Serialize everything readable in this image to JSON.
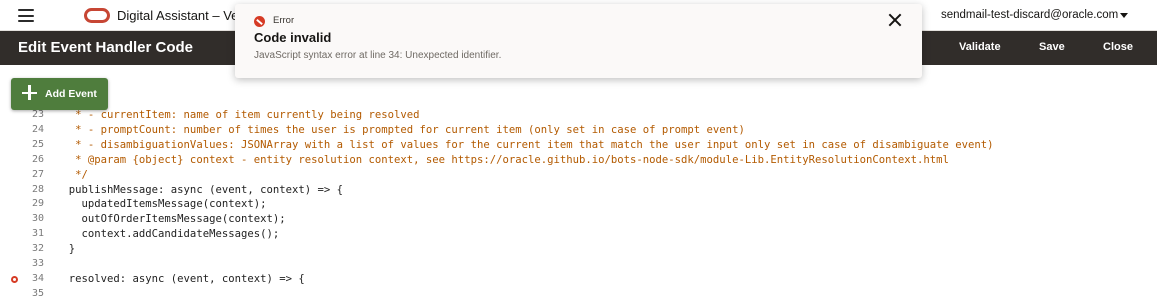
{
  "app": {
    "title": "Digital Assistant – Version",
    "user": "sendmail-test-discard@oracle.com"
  },
  "header": {
    "title": "Edit Event Handler Code",
    "validate_label": "Validate",
    "save_label": "Save",
    "close_label": "Close"
  },
  "add_event_label": "Add Event",
  "toast": {
    "category": "Error",
    "title": "Code invalid",
    "message": "JavaScript syntax error at line 34: Unexpected identifier."
  },
  "colors": {
    "header_bg": "#312d2a",
    "brand_red": "#c74634",
    "add_button": "#4f7d3d",
    "error": "#d63b25",
    "comment": "#b35a00"
  },
  "icons": [
    "hamburger-menu-icon",
    "oracle-logo",
    "user-dropdown-caret-icon",
    "error-icon",
    "close-icon",
    "plus-icon",
    "error-marker-icon"
  ],
  "code": {
    "error_line": 34,
    "lines": [
      {
        "num": "23",
        "text": "   * - currentItem: name of item currently being resolved",
        "kind": "comment"
      },
      {
        "num": "24",
        "text": "   * - promptCount: number of times the user is prompted for current item (only set in case of prompt event)",
        "kind": "comment"
      },
      {
        "num": "25",
        "text": "   * - disambiguationValues: JSONArray with a list of values for the current item that match the user input only set in case of disambiguate event)",
        "kind": "comment"
      },
      {
        "num": "26",
        "text": "   * @param {object} context - entity resolution context, see https://oracle.github.io/bots-node-sdk/module-Lib.EntityResolutionContext.html",
        "kind": "comment"
      },
      {
        "num": "27",
        "text": "   */",
        "kind": "comment"
      },
      {
        "num": "28",
        "text": "  publishMessage: async (event, context) => {",
        "kind": "code"
      },
      {
        "num": "29",
        "text": "    updatedItemsMessage(context);",
        "kind": "code"
      },
      {
        "num": "30",
        "text": "    outOfOrderItemsMessage(context);",
        "kind": "code"
      },
      {
        "num": "31",
        "text": "    context.addCandidateMessages();",
        "kind": "code"
      },
      {
        "num": "32",
        "text": "  }",
        "kind": "code"
      },
      {
        "num": "33",
        "text": "",
        "kind": "code"
      },
      {
        "num": "34",
        "text": "  resolved: async (event, context) => {",
        "kind": "code"
      },
      {
        "num": "35",
        "text": "",
        "kind": "code"
      }
    ]
  }
}
